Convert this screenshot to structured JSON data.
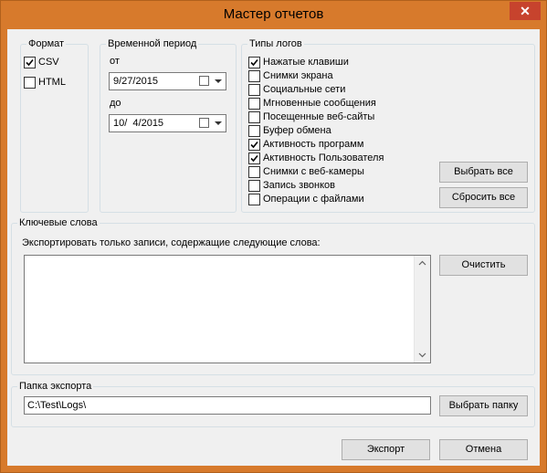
{
  "window": {
    "title": "Мастер отчетов",
    "close_glyph": "✕"
  },
  "format": {
    "legend": "Формат",
    "options": [
      {
        "label": "CSV",
        "checked": true
      },
      {
        "label": "HTML",
        "checked": false
      }
    ]
  },
  "period": {
    "legend": "Временной период",
    "from_label": "от",
    "from_value": "9/27/2015",
    "to_label": "до",
    "to_value": "10/  4/2015"
  },
  "log_types": {
    "legend": "Типы логов",
    "items": [
      {
        "label": "Нажатые клавиши",
        "checked": true
      },
      {
        "label": "Снимки экрана",
        "checked": false
      },
      {
        "label": "Социальные сети",
        "checked": false
      },
      {
        "label": "Мгновенные сообщения",
        "checked": false
      },
      {
        "label": "Посещенные веб-сайты",
        "checked": false
      },
      {
        "label": "Буфер обмена",
        "checked": false
      },
      {
        "label": "Активность программ",
        "checked": true
      },
      {
        "label": "Активность Пользователя",
        "checked": true
      },
      {
        "label": "Снимки с веб-камеры",
        "checked": false
      },
      {
        "label": "Запись звонков",
        "checked": false
      },
      {
        "label": "Операции с файлами",
        "checked": false
      }
    ],
    "select_all": "Выбрать все",
    "reset_all": "Сбросить все"
  },
  "keywords": {
    "legend": "Ключевые слова",
    "description": "Экспортировать только записи, содержащие следующие слова:",
    "value": "",
    "clear": "Очистить"
  },
  "export_folder": {
    "legend": "Папка экспорта",
    "path": "C:\\Test\\Logs\\",
    "browse": "Выбрать папку"
  },
  "footer": {
    "export": "Экспорт",
    "cancel": "Отмена"
  }
}
